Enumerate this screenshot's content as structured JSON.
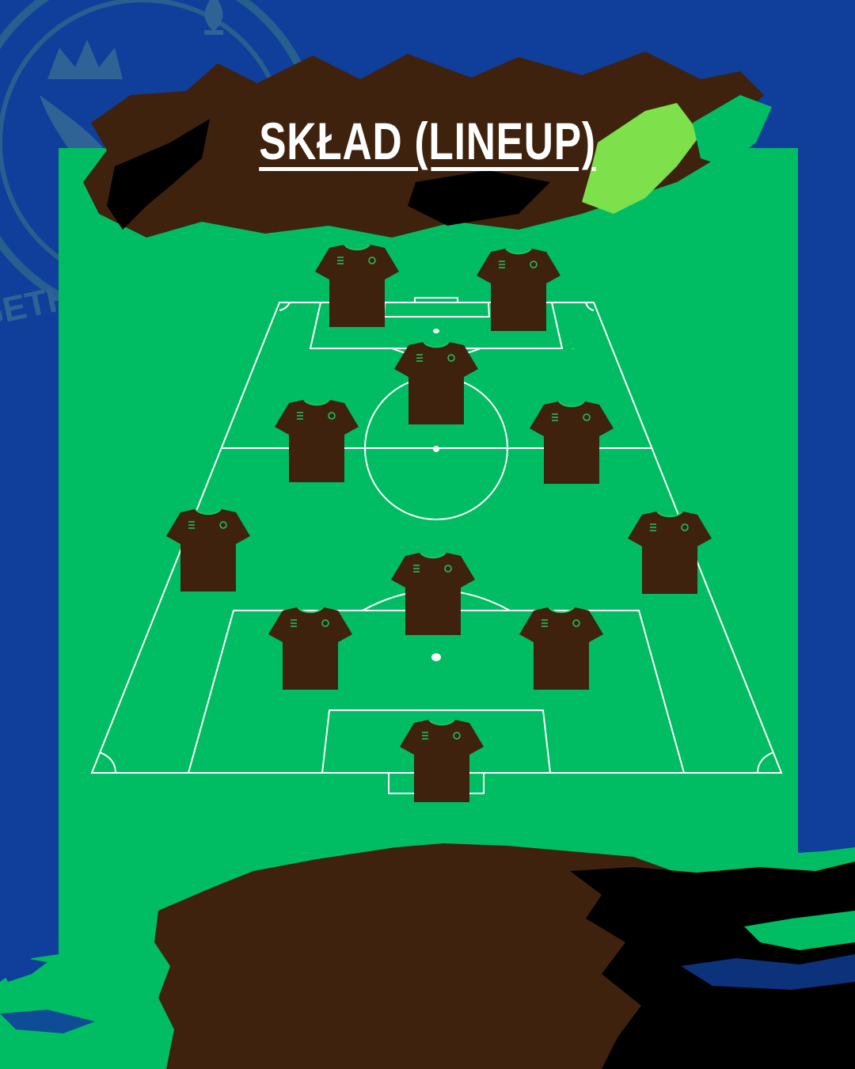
{
  "header": {
    "title": "SKŁAD (LINEUP)"
  },
  "watermark": {
    "text": "TOGETHER WE ARE... NC"
  },
  "colors": {
    "background_blue": "#0f3f9a",
    "pitch_green": "#00bd63",
    "jersey_brown": "#3e220e",
    "jersey_trim": "#22c55e",
    "line_white": "#ffffff",
    "accent_lime": "#7ee04a"
  },
  "formation": {
    "players": [
      "striker-left",
      "striker-right",
      "attacking-mid",
      "center-mid-left",
      "center-mid-right",
      "wide-left",
      "wide-right",
      "defensive-mid",
      "center-back-left",
      "center-back-right",
      "goalkeeper"
    ]
  }
}
